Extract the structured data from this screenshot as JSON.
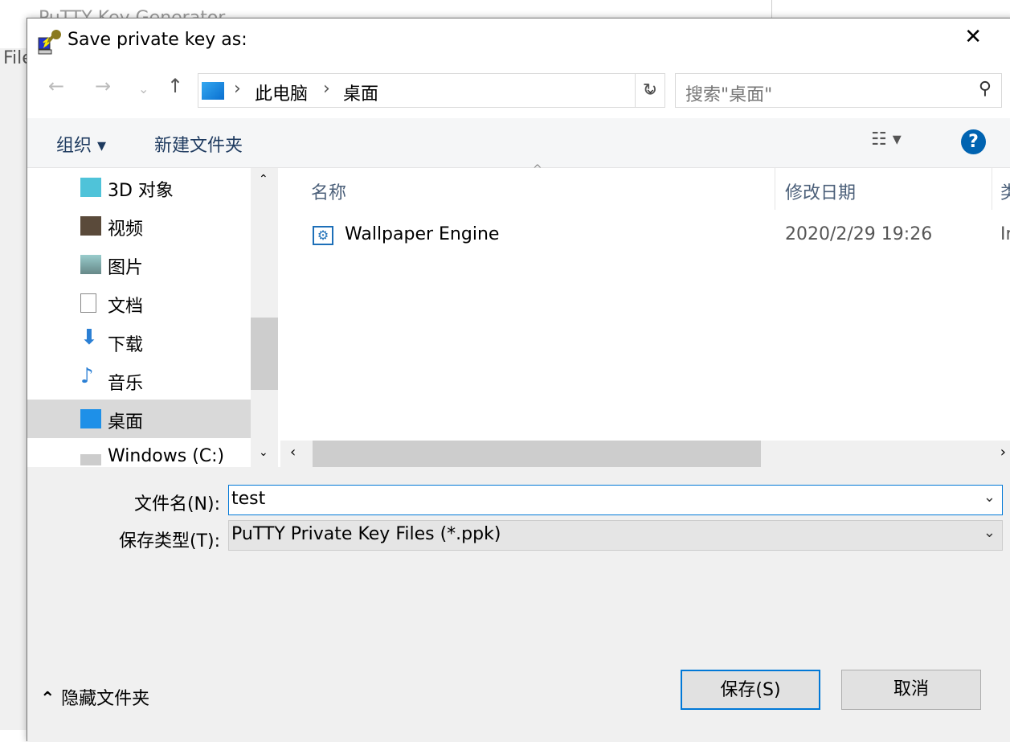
{
  "background_window": {
    "title": "PuTTY Key Generator",
    "menu": "File"
  },
  "dialog": {
    "title": "Save private key as:",
    "close_label": "✕",
    "address": {
      "segments": [
        "此电脑",
        "桌面"
      ]
    },
    "search_placeholder": "搜索\"桌面\"",
    "toolbar": {
      "organize": "组织 ▾",
      "new_folder": "新建文件夹",
      "help": "?"
    },
    "nav_items": [
      {
        "label": "3D 对象",
        "icon": "cube-icon"
      },
      {
        "label": "视频",
        "icon": "video-icon"
      },
      {
        "label": "图片",
        "icon": "pictures-icon"
      },
      {
        "label": "文档",
        "icon": "document-icon"
      },
      {
        "label": "下载",
        "icon": "download-icon"
      },
      {
        "label": "音乐",
        "icon": "music-icon"
      },
      {
        "label": "桌面",
        "icon": "desktop-icon",
        "selected": true
      },
      {
        "label": "Windows (C:)",
        "icon": "drive-icon"
      }
    ],
    "columns": {
      "name": "名称",
      "modified": "修改日期",
      "type": "类"
    },
    "files": [
      {
        "name": "Wallpaper Engine",
        "modified": "2020/2/29 19:26",
        "type": "In"
      }
    ],
    "filename_label": "文件名(N):",
    "filename_value": "test",
    "filetype_label": "保存类型(T):",
    "filetype_value": "PuTTY Private Key Files (*.ppk)",
    "hide_folders": "隐藏文件夹",
    "save": "保存(S)",
    "cancel": "取消"
  }
}
